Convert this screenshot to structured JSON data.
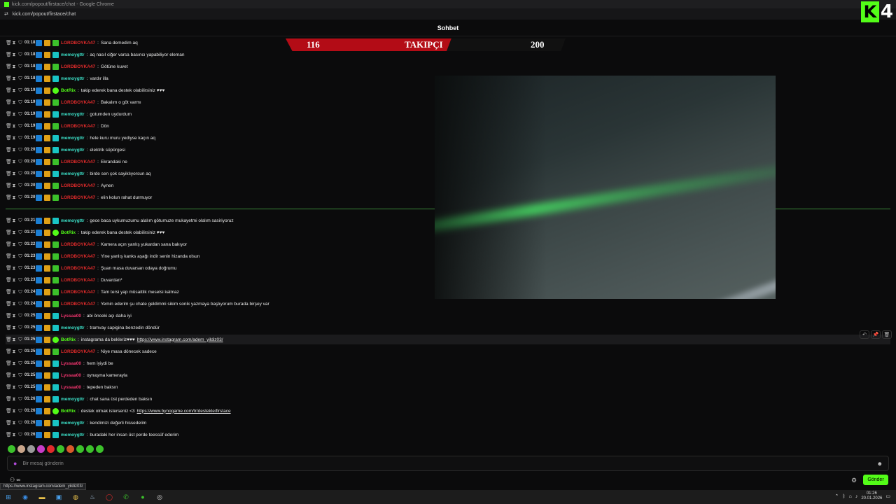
{
  "browser": {
    "window_title": "kick.com/popout/firstace/chat - Google Chrome",
    "url": "kick.com/popout/firstace/chat"
  },
  "brand": {
    "logo_number": "4"
  },
  "chat": {
    "title": "Sohbet",
    "follower_goal": {
      "current": "116",
      "label": "TAKIPÇI",
      "target": "200"
    },
    "messages": [
      {
        "time": "01:18",
        "user": "LORDBOYKA47",
        "color": "#e02b2b",
        "badge": "gsq",
        "text": "Sana demedim aq"
      },
      {
        "time": "01:18",
        "user": "memoygttr",
        "color": "#3ce0c8",
        "badge": "teal",
        "text": "aq nasıl ciğer varsa basıncı yapabiliyor eleman"
      },
      {
        "time": "01:18",
        "user": "LORDBOYKA47",
        "color": "#e02b2b",
        "badge": "gsq",
        "text": "Götüne kuvet"
      },
      {
        "time": "01:18",
        "user": "memoygttr",
        "color": "#3ce0c8",
        "badge": "teal",
        "text": "vardır illa"
      },
      {
        "time": "01:19",
        "user": "BotRix",
        "color": "#53fc18",
        "badge": "green",
        "text": "takip ederek bana destek olabilirsiniz ♥♥♥"
      },
      {
        "time": "01:19",
        "user": "LORDBOYKA47",
        "color": "#e02b2b",
        "badge": "gsq",
        "text": "Bakalım o göt varmı"
      },
      {
        "time": "01:19",
        "user": "memoygttr",
        "color": "#3ce0c8",
        "badge": "teal",
        "text": "gotumden uydurdum"
      },
      {
        "time": "01:19",
        "user": "LORDBOYKA47",
        "color": "#e02b2b",
        "badge": "gsq",
        "text": "Dön"
      },
      {
        "time": "01:19",
        "user": "memoygttr",
        "color": "#3ce0c8",
        "badge": "teal",
        "text": "hele kuru muru yediyse kaçın aq"
      },
      {
        "time": "01:20",
        "user": "memoygttr",
        "color": "#3ce0c8",
        "badge": "teal",
        "text": "elektrik süpürgesi"
      },
      {
        "time": "01:20",
        "user": "LORDBOYKA47",
        "color": "#e02b2b",
        "badge": "gsq",
        "text": "Ekrandaki ne"
      },
      {
        "time": "01:20",
        "user": "memoygttr",
        "color": "#3ce0c8",
        "badge": "teal",
        "text": "birde sen çok sayiklıyorsun aq"
      },
      {
        "time": "01:20",
        "user": "LORDBOYKA47",
        "color": "#e02b2b",
        "badge": "gsq",
        "text": "Aynen"
      },
      {
        "time": "01:20",
        "user": "LORDBOYKA47",
        "color": "#e02b2b",
        "badge": "gsq",
        "text": "elin kolun rahat durmuyor"
      },
      {
        "time": "01:21",
        "user": "memoygttr",
        "color": "#3ce0c8",
        "badge": "teal",
        "text": "gece baca uykumuzumu alalım götumuze mukayetmi olalım sasiriyoruz"
      },
      {
        "time": "01:21",
        "user": "BotRix",
        "color": "#53fc18",
        "badge": "green",
        "text": "takip ederek bana destek olabilirsiniz ♥♥♥"
      },
      {
        "time": "01:22",
        "user": "LORDBOYKA47",
        "color": "#e02b2b",
        "badge": "gsq",
        "text": "Kamera açın yanlış yukardan sana bakıyor"
      },
      {
        "time": "01:23",
        "user": "LORDBOYKA47",
        "color": "#e02b2b",
        "badge": "gsq",
        "text": "Yine yanlış kanks aşağı indir senin hizanda olsun"
      },
      {
        "time": "01:23",
        "user": "LORDBOYKA47",
        "color": "#e02b2b",
        "badge": "gsq",
        "text": "Şuan masa duvarsan odaya doğrumu"
      },
      {
        "time": "01:23",
        "user": "LORDBOYKA47",
        "color": "#e02b2b",
        "badge": "gsq",
        "text": "Duvardan*"
      },
      {
        "time": "01:24",
        "user": "LORDBOYKA47",
        "color": "#e02b2b",
        "badge": "gsq",
        "text": "Tam tersi yap müsaitlik meselsi kalmaz"
      },
      {
        "time": "01:24",
        "user": "LORDBOYKA47",
        "color": "#e02b2b",
        "badge": "gsq",
        "text": "Yemin ederim şu chate geldimmi sikim sonik yazmaya başlıyorum burada birşey var"
      },
      {
        "time": "01:25",
        "user": "Lyssaa00",
        "color": "#f0356e",
        "badge": "teal",
        "text": "abi önceki açı daha iyi"
      },
      {
        "time": "01:25",
        "user": "memoygttr",
        "color": "#3ce0c8",
        "badge": "teal",
        "text": "tramvay sapigina benzedin döndür"
      },
      {
        "time": "01:25",
        "user": "BotRix",
        "color": "#53fc18",
        "badge": "green",
        "text": "instagrama da bekleriz♥♥♥",
        "link": "https://www.instagram.com/adem_yildiz03/",
        "hl": true
      },
      {
        "time": "01:25",
        "user": "LORDBOYKA47",
        "color": "#e02b2b",
        "badge": "gsq",
        "text": "Niye masa dönecek sadece"
      },
      {
        "time": "01:25",
        "user": "Lyssaa00",
        "color": "#f0356e",
        "badge": "teal",
        "text": "hem iyiydi be"
      },
      {
        "time": "01:25",
        "user": "Lyssaa00",
        "color": "#f0356e",
        "badge": "teal",
        "text": "oynaşma kamerayla"
      },
      {
        "time": "01:25",
        "user": "Lyssaa00",
        "color": "#f0356e",
        "badge": "teal",
        "text": "tepeden baksın"
      },
      {
        "time": "01:26",
        "user": "memoygttr",
        "color": "#3ce0c8",
        "badge": "teal",
        "text": "chat sana üst perdeden baksın"
      },
      {
        "time": "01:26",
        "user": "BotRix",
        "color": "#53fc18",
        "badge": "green",
        "text": "destek olmak isterseniz <3",
        "link": "https://www.bynogame.com/tr/destekle/firstace"
      },
      {
        "time": "01:26",
        "user": "memoygttr",
        "color": "#3ce0c8",
        "badge": "teal",
        "text": "kendimizi değerli hissedelim"
      },
      {
        "time": "01:26",
        "user": "memoygttr",
        "color": "#3ce0c8",
        "badge": "teal",
        "text": "buradaki her insan üst perde teessüf ederim"
      }
    ],
    "input_placeholder": "Bir mesaj gönderin",
    "send_label": "Gönder",
    "bottom_left": "∞"
  },
  "status_url": "https://www.instagram.com/adem_yildiz03/",
  "taskbar": {
    "time": "01:26",
    "date": "20.01.2026"
  }
}
